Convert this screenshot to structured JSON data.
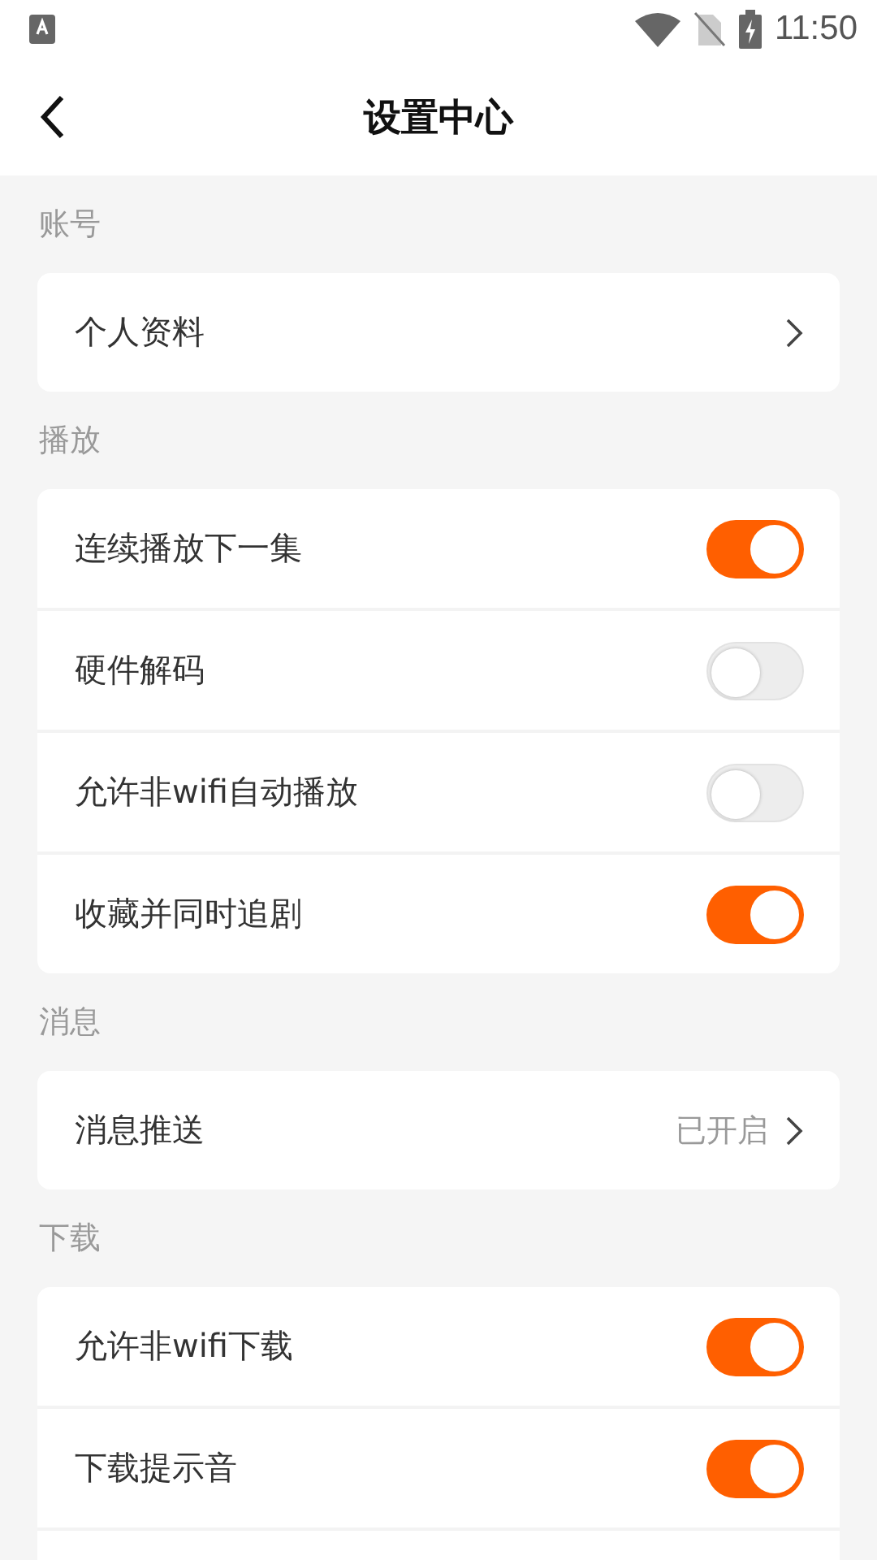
{
  "status_bar": {
    "time": "11:50"
  },
  "header": {
    "title": "设置中心"
  },
  "sections": [
    {
      "title": "账号",
      "items": [
        {
          "kind": "link",
          "label": "个人资料"
        }
      ]
    },
    {
      "title": "播放",
      "items": [
        {
          "kind": "toggle",
          "label": "连续播放下一集",
          "on": true
        },
        {
          "kind": "toggle",
          "label": "硬件解码",
          "on": false
        },
        {
          "kind": "toggle",
          "label": "允许非wifi自动播放",
          "on": false
        },
        {
          "kind": "toggle",
          "label": "收藏并同时追剧",
          "on": true
        }
      ]
    },
    {
      "title": "消息",
      "items": [
        {
          "kind": "link",
          "label": "消息推送",
          "value": "已开启"
        }
      ]
    },
    {
      "title": "下载",
      "items": [
        {
          "kind": "toggle",
          "label": "允许非wifi下载",
          "on": true
        },
        {
          "kind": "toggle",
          "label": "下载提示音",
          "on": true
        }
      ],
      "more_below": true
    }
  ]
}
